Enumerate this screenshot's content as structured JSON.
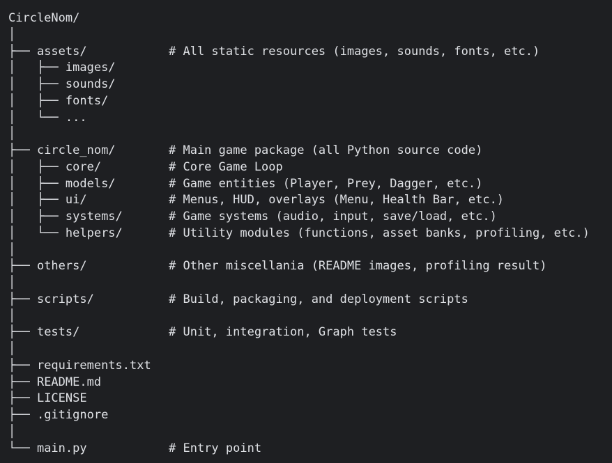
{
  "lines": [
    {
      "tree": "",
      "name": "CircleNom/",
      "comment": ""
    },
    {
      "tree": "│",
      "name": "",
      "comment": ""
    },
    {
      "tree": "├── ",
      "name": "assets/",
      "comment": "# All static resources (images, sounds, fonts, etc.)"
    },
    {
      "tree": "│   ├── ",
      "name": "images/",
      "comment": ""
    },
    {
      "tree": "│   ├── ",
      "name": "sounds/",
      "comment": ""
    },
    {
      "tree": "│   ├── ",
      "name": "fonts/",
      "comment": ""
    },
    {
      "tree": "│   └── ",
      "name": "...",
      "comment": ""
    },
    {
      "tree": "│",
      "name": "",
      "comment": ""
    },
    {
      "tree": "├── ",
      "name": "circle_nom/",
      "comment": "# Main game package (all Python source code)"
    },
    {
      "tree": "│   ├── ",
      "name": "core/",
      "comment": "# Core Game Loop"
    },
    {
      "tree": "│   ├── ",
      "name": "models/",
      "comment": "# Game entities (Player, Prey, Dagger, etc.)"
    },
    {
      "tree": "│   ├── ",
      "name": "ui/",
      "comment": "# Menus, HUD, overlays (Menu, Health Bar, etc.)"
    },
    {
      "tree": "│   ├── ",
      "name": "systems/",
      "comment": "# Game systems (audio, input, save/load, etc.)"
    },
    {
      "tree": "│   └── ",
      "name": "helpers/",
      "comment": "# Utility modules (functions, asset banks, profiling, etc.)"
    },
    {
      "tree": "│",
      "name": "",
      "comment": ""
    },
    {
      "tree": "├── ",
      "name": "others/",
      "comment": "# Other miscellania (README images, profiling result)"
    },
    {
      "tree": "│",
      "name": "",
      "comment": ""
    },
    {
      "tree": "├── ",
      "name": "scripts/",
      "comment": "# Build, packaging, and deployment scripts"
    },
    {
      "tree": "│",
      "name": "",
      "comment": ""
    },
    {
      "tree": "├── ",
      "name": "tests/",
      "comment": "# Unit, integration, Graph tests"
    },
    {
      "tree": "│",
      "name": "",
      "comment": ""
    },
    {
      "tree": "├── ",
      "name": "requirements.txt",
      "comment": ""
    },
    {
      "tree": "├── ",
      "name": "README.md",
      "comment": ""
    },
    {
      "tree": "├── ",
      "name": "LICENSE",
      "comment": ""
    },
    {
      "tree": "├── ",
      "name": ".gitignore",
      "comment": ""
    },
    {
      "tree": "│",
      "name": "",
      "comment": ""
    },
    {
      "tree": "└── ",
      "name": "main.py",
      "comment": "# Entry point"
    }
  ]
}
